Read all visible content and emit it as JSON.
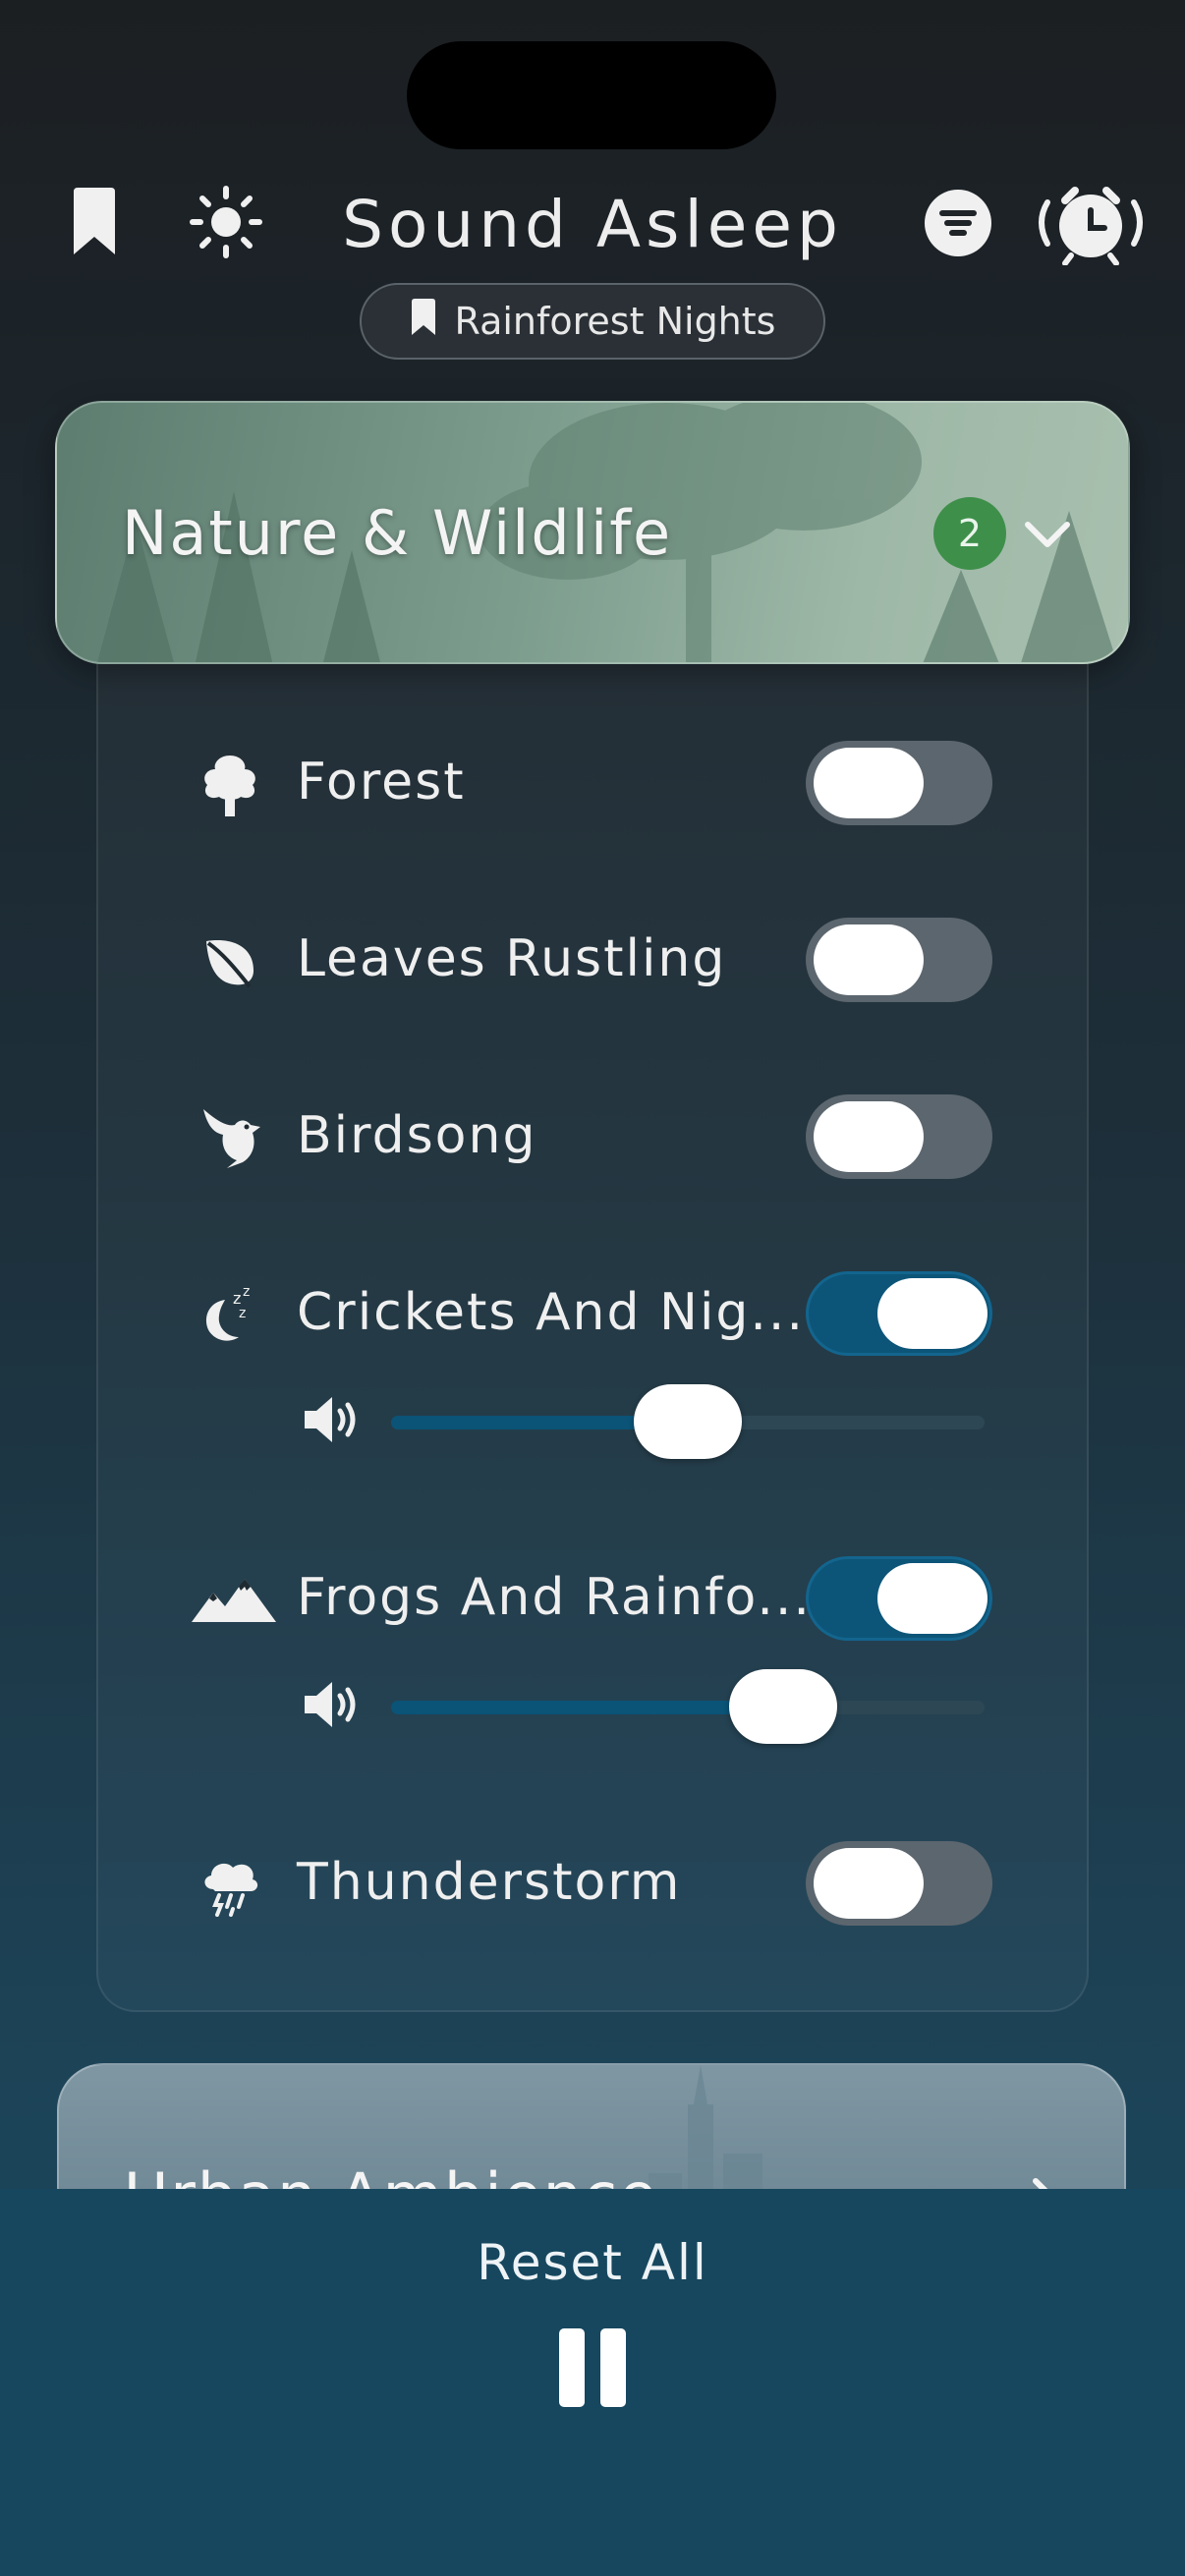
{
  "header": {
    "title": "Sound Asleep",
    "active_preset": "Rainforest Nights",
    "icons": [
      "bookmark-icon",
      "brightness-icon",
      "filter-icon",
      "alarm-clock-icon"
    ]
  },
  "category": {
    "title": "Nature & Wildlife",
    "active_count": "2",
    "expanded": true,
    "sounds": [
      {
        "label": "Forest",
        "icon": "tree-icon",
        "on": false
      },
      {
        "label": "Leaves Rustling",
        "icon": "leaf-icon",
        "on": false
      },
      {
        "label": "Birdsong",
        "icon": "bird-icon",
        "on": false
      },
      {
        "label": "Crickets And Nig...",
        "icon": "moon-sleep-icon",
        "on": true,
        "volume": 0.5
      },
      {
        "label": "Frogs And Rainfo...",
        "icon": "mountains-icon",
        "on": true,
        "volume": 0.66
      },
      {
        "label": "Thunderstorm",
        "icon": "storm-cloud-icon",
        "on": false
      }
    ]
  },
  "next_category": {
    "title": "Urban Ambience"
  },
  "bottom": {
    "reset_label": "Reset All",
    "playback_state": "playing"
  },
  "colors": {
    "accent": "#0d5578",
    "badge": "#3e8f4a",
    "toggle_off": "#5c666e"
  }
}
